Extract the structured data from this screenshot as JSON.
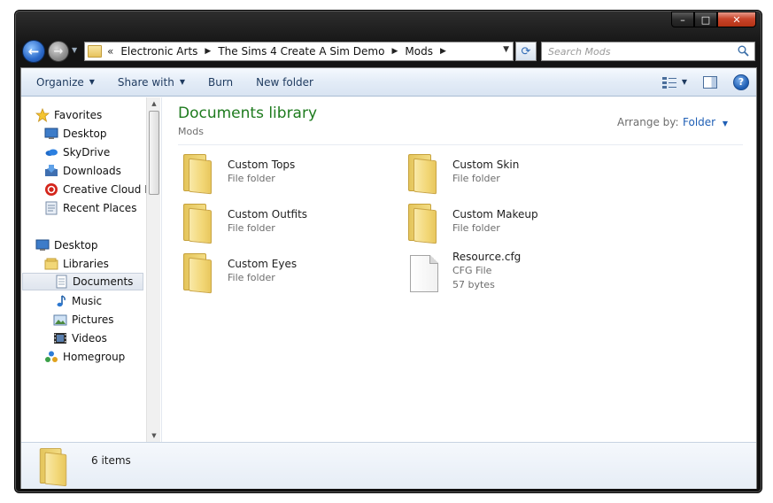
{
  "window": {
    "caption_buttons": {
      "minimize": "–",
      "maximize": "□",
      "close": "✕"
    }
  },
  "nav": {
    "back_glyph": "←",
    "forward_glyph": "→",
    "address_prefix": "«",
    "breadcrumbs": [
      "Electronic Arts",
      "The Sims 4 Create A Sim Demo",
      "Mods"
    ],
    "search_placeholder": "Search Mods"
  },
  "toolbar": {
    "organize": "Organize",
    "share_with": "Share with",
    "burn": "Burn",
    "new_folder": "New folder",
    "help": "?"
  },
  "sidebar": {
    "items": [
      {
        "label": "Favorites",
        "icon": "star-icon"
      },
      {
        "label": "Desktop",
        "icon": "desktop-icon"
      },
      {
        "label": "SkyDrive",
        "icon": "skydrive-icon"
      },
      {
        "label": "Downloads",
        "icon": "downloads-icon"
      },
      {
        "label": "Creative Cloud Fi",
        "icon": "creative-cloud-icon"
      },
      {
        "label": "Recent Places",
        "icon": "recent-places-icon"
      },
      {
        "label": "Desktop",
        "icon": "desktop-icon"
      },
      {
        "label": "Libraries",
        "icon": "libraries-icon"
      },
      {
        "label": "Documents",
        "icon": "documents-icon",
        "selected": true
      },
      {
        "label": "Music",
        "icon": "music-icon"
      },
      {
        "label": "Pictures",
        "icon": "pictures-icon"
      },
      {
        "label": "Videos",
        "icon": "videos-icon"
      },
      {
        "label": "Homegroup",
        "icon": "homegroup-icon"
      }
    ]
  },
  "main": {
    "title": "Documents library",
    "subtitle": "Mods",
    "arrange_label": "Arrange by:",
    "arrange_value": "Folder",
    "files": [
      {
        "name": "Custom Tops",
        "type": "File folder",
        "size": "",
        "icon": "folder-icon"
      },
      {
        "name": "Custom Skin",
        "type": "File folder",
        "size": "",
        "icon": "folder-icon"
      },
      {
        "name": "Custom Outfits",
        "type": "File folder",
        "size": "",
        "icon": "folder-icon"
      },
      {
        "name": "Custom Makeup",
        "type": "File folder",
        "size": "",
        "icon": "folder-icon"
      },
      {
        "name": "Custom Eyes",
        "type": "File folder",
        "size": "",
        "icon": "folder-icon"
      },
      {
        "name": "Resource.cfg",
        "type": "CFG File",
        "size": "57 bytes",
        "icon": "file-icon"
      }
    ]
  },
  "details": {
    "count": "6 items"
  },
  "colors": {
    "title_green": "#1e7b1e",
    "link_blue": "#1f5fb5",
    "frame_dark": "#141414"
  }
}
